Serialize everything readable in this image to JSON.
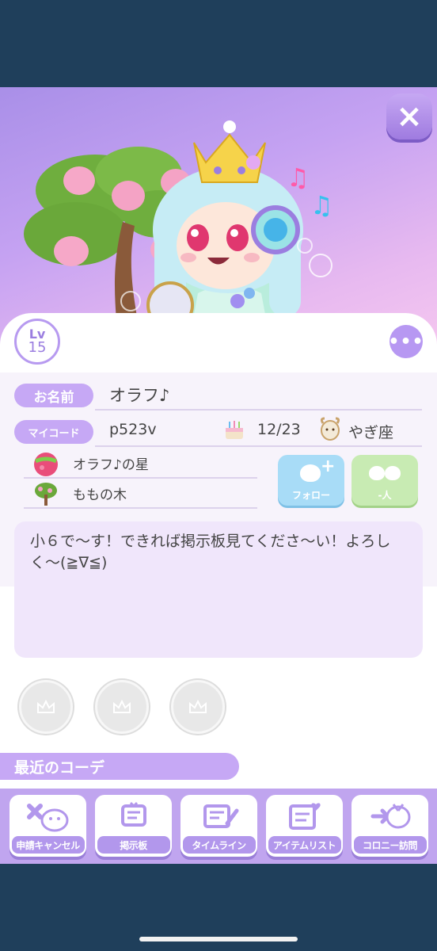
{
  "profile": {
    "level_label": "Lv",
    "level": "15",
    "name_label": "お名前",
    "name": "オラフ♪",
    "code_label": "マイコード",
    "code": "p523v",
    "birthday": "12/23",
    "zodiac": "やぎ座",
    "star": "オラフ♪の星",
    "tree": "ももの木"
  },
  "buttons": {
    "close": "×",
    "more": "•••",
    "follow": "フォロー",
    "members": "-人"
  },
  "bio": "小６で〜す！できれば掲示板見てくださ〜い！よろしく〜(≧∇≦)",
  "recent_label": "最近のコーデ",
  "nav": [
    {
      "label": "申請キャンセル",
      "icon": "cancel-request-icon"
    },
    {
      "label": "掲示板",
      "icon": "bulletin-board-icon"
    },
    {
      "label": "タイムライン",
      "icon": "timeline-icon"
    },
    {
      "label": "アイテムリスト",
      "icon": "item-list-icon"
    },
    {
      "label": "コロニー訪問",
      "icon": "colony-visit-icon"
    }
  ],
  "colors": {
    "accent": "#c6a8f5",
    "follow": "#a8dcf7",
    "members": "#c8ebb3",
    "bio_bg": "#f0e6fb"
  }
}
